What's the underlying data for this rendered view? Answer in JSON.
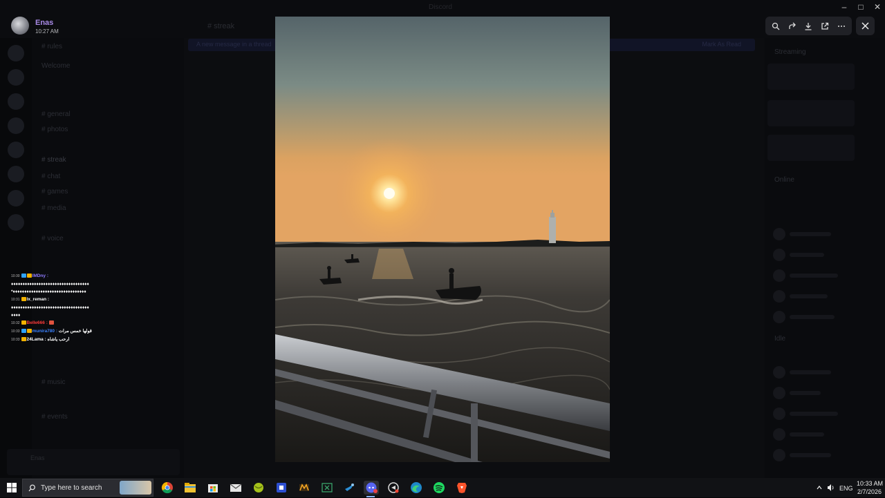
{
  "window": {
    "title": "Discord"
  },
  "background": {
    "channel_title": "# streak",
    "banner_text": "A new message in a thread",
    "banner_action": "Mark As Read",
    "channels": [
      "# rules",
      "Welcome",
      "# general",
      "# photos",
      "# streak",
      "# chat",
      "# games",
      "# media",
      "# voice",
      "# music",
      "# events"
    ],
    "member_names": [
      "Streaming",
      "Online",
      "Idle"
    ],
    "user_panel_name": "Enas"
  },
  "viewer": {
    "uploader_name": "Enas",
    "uploader_time": "10:27 AM",
    "toolbar": [
      "zoom-icon",
      "forward-icon",
      "download-icon",
      "open-external-icon",
      "more-icon"
    ],
    "close": "close-icon"
  },
  "overlay_chat": [
    {
      "time": "10:30",
      "user": "IMDny :",
      "user_color": "#8f7bff",
      "text": ""
    },
    {
      "time": "",
      "user": "",
      "user_color": "#ffffff",
      "text": "♦♦♦♦♦♦♦♦♦♦♦♦♦♦♦♦♦♦♦♦♦♦♦♦♦♦♦♦♦♦♦♦♦♦"
    },
    {
      "time": "",
      "user": "",
      "user_color": "#ffffff",
      "text": "*♦♦♦♦♦♦♦♦♦♦♦♦♦♦♦♦♦♦♦♦♦♦♦♦♦♦♦♦♦♦♦♦"
    },
    {
      "time": "10:31",
      "user": "lx_reman :",
      "user_color": "#ffffff",
      "text": ""
    },
    {
      "time": "",
      "user": "",
      "user_color": "#ffffff",
      "text": "♦♦♦♦♦♦♦♦♦♦♦♦♦♦♦♦♦♦♦♦♦♦♦♦♦♦♦♦♦♦♦♦♦♦"
    },
    {
      "time": "",
      "user": "",
      "user_color": "#ffffff",
      "text": "♦♦♦♦"
    },
    {
      "time": "10:32",
      "user": "Belle666 :",
      "user_color": "#ff3a3a",
      "text": ""
    },
    {
      "time": "10:33",
      "user": "munira780 :",
      "user_color": "#3b82ff",
      "text": "قولها خمس مرات"
    },
    {
      "time": "10:33",
      "user": "24Lama :",
      "user_color": "#ffffff",
      "text": "ارحب ياشاه"
    }
  ],
  "taskbar": {
    "search_placeholder": "Type here to search",
    "apps": [
      "chrome-icon",
      "file-explorer-icon",
      "store-icon",
      "mail-icon",
      "app-green-icon",
      "app-blue-icon",
      "app-orange-icon",
      "xbox-icon",
      "steam-icon",
      "discord-icon",
      "app-recorder-icon",
      "edge-icon",
      "spotify-icon",
      "brave-icon"
    ],
    "language": "ENG",
    "clock_time": "10:33 AM",
    "clock_date": "2/7/2026"
  },
  "colors": {
    "accent": "#a88ae6",
    "taskbar": "#111215",
    "overlay_bg": "#050507"
  }
}
